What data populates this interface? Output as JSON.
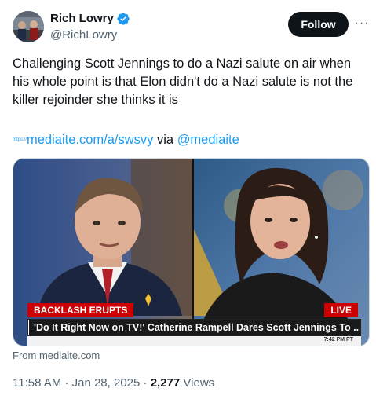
{
  "author": {
    "display_name": "Rich Lowry",
    "handle": "@RichLowry",
    "verified": true
  },
  "actions": {
    "follow_label": "Follow",
    "more_label": "···"
  },
  "tweet": {
    "text": "Challenging Scott Jennings to do a Nazi salute on air when his whole point is that Elon didn't do a Nazi salute is not the killer rejoinder she thinks it is",
    "link_prefix": "https://",
    "link_text": "mediaite.com/a/swsvy",
    "via_text": "via",
    "mention": "@mediaite"
  },
  "card": {
    "banner_label": "BACKLASH ERUPTS",
    "live_label": "LIVE",
    "headline": "'Do It Right Now on TV!' Catherine Rampell Dares Scott Jennings To ...",
    "time": "7:42 PM PT",
    "source": "From mediaite.com"
  },
  "meta": {
    "time": "11:58 AM",
    "date": "Jan 28, 2025",
    "separator": "·",
    "views_count": "2,277",
    "views_label": "Views"
  },
  "colors": {
    "accent": "#1d9bf0",
    "text": "#0f1419",
    "muted": "#536471",
    "cnn_red": "#cc0000"
  }
}
